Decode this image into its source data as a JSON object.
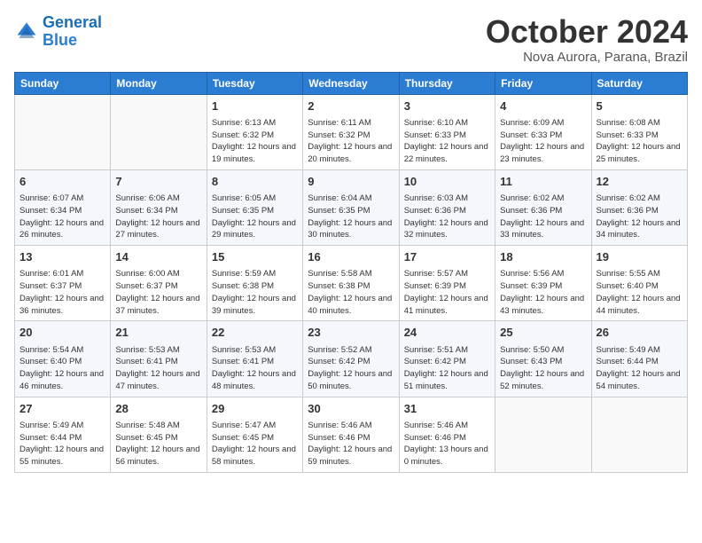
{
  "header": {
    "logo_line1": "General",
    "logo_line2": "Blue",
    "month": "October 2024",
    "location": "Nova Aurora, Parana, Brazil"
  },
  "days_of_week": [
    "Sunday",
    "Monday",
    "Tuesday",
    "Wednesday",
    "Thursday",
    "Friday",
    "Saturday"
  ],
  "weeks": [
    [
      {
        "day": "",
        "detail": ""
      },
      {
        "day": "",
        "detail": ""
      },
      {
        "day": "1",
        "detail": "Sunrise: 6:13 AM\nSunset: 6:32 PM\nDaylight: 12 hours\nand 19 minutes."
      },
      {
        "day": "2",
        "detail": "Sunrise: 6:11 AM\nSunset: 6:32 PM\nDaylight: 12 hours\nand 20 minutes."
      },
      {
        "day": "3",
        "detail": "Sunrise: 6:10 AM\nSunset: 6:33 PM\nDaylight: 12 hours\nand 22 minutes."
      },
      {
        "day": "4",
        "detail": "Sunrise: 6:09 AM\nSunset: 6:33 PM\nDaylight: 12 hours\nand 23 minutes."
      },
      {
        "day": "5",
        "detail": "Sunrise: 6:08 AM\nSunset: 6:33 PM\nDaylight: 12 hours\nand 25 minutes."
      }
    ],
    [
      {
        "day": "6",
        "detail": "Sunrise: 6:07 AM\nSunset: 6:34 PM\nDaylight: 12 hours\nand 26 minutes."
      },
      {
        "day": "7",
        "detail": "Sunrise: 6:06 AM\nSunset: 6:34 PM\nDaylight: 12 hours\nand 27 minutes."
      },
      {
        "day": "8",
        "detail": "Sunrise: 6:05 AM\nSunset: 6:35 PM\nDaylight: 12 hours\nand 29 minutes."
      },
      {
        "day": "9",
        "detail": "Sunrise: 6:04 AM\nSunset: 6:35 PM\nDaylight: 12 hours\nand 30 minutes."
      },
      {
        "day": "10",
        "detail": "Sunrise: 6:03 AM\nSunset: 6:36 PM\nDaylight: 12 hours\nand 32 minutes."
      },
      {
        "day": "11",
        "detail": "Sunrise: 6:02 AM\nSunset: 6:36 PM\nDaylight: 12 hours\nand 33 minutes."
      },
      {
        "day": "12",
        "detail": "Sunrise: 6:02 AM\nSunset: 6:36 PM\nDaylight: 12 hours\nand 34 minutes."
      }
    ],
    [
      {
        "day": "13",
        "detail": "Sunrise: 6:01 AM\nSunset: 6:37 PM\nDaylight: 12 hours\nand 36 minutes."
      },
      {
        "day": "14",
        "detail": "Sunrise: 6:00 AM\nSunset: 6:37 PM\nDaylight: 12 hours\nand 37 minutes."
      },
      {
        "day": "15",
        "detail": "Sunrise: 5:59 AM\nSunset: 6:38 PM\nDaylight: 12 hours\nand 39 minutes."
      },
      {
        "day": "16",
        "detail": "Sunrise: 5:58 AM\nSunset: 6:38 PM\nDaylight: 12 hours\nand 40 minutes."
      },
      {
        "day": "17",
        "detail": "Sunrise: 5:57 AM\nSunset: 6:39 PM\nDaylight: 12 hours\nand 41 minutes."
      },
      {
        "day": "18",
        "detail": "Sunrise: 5:56 AM\nSunset: 6:39 PM\nDaylight: 12 hours\nand 43 minutes."
      },
      {
        "day": "19",
        "detail": "Sunrise: 5:55 AM\nSunset: 6:40 PM\nDaylight: 12 hours\nand 44 minutes."
      }
    ],
    [
      {
        "day": "20",
        "detail": "Sunrise: 5:54 AM\nSunset: 6:40 PM\nDaylight: 12 hours\nand 46 minutes."
      },
      {
        "day": "21",
        "detail": "Sunrise: 5:53 AM\nSunset: 6:41 PM\nDaylight: 12 hours\nand 47 minutes."
      },
      {
        "day": "22",
        "detail": "Sunrise: 5:53 AM\nSunset: 6:41 PM\nDaylight: 12 hours\nand 48 minutes."
      },
      {
        "day": "23",
        "detail": "Sunrise: 5:52 AM\nSunset: 6:42 PM\nDaylight: 12 hours\nand 50 minutes."
      },
      {
        "day": "24",
        "detail": "Sunrise: 5:51 AM\nSunset: 6:42 PM\nDaylight: 12 hours\nand 51 minutes."
      },
      {
        "day": "25",
        "detail": "Sunrise: 5:50 AM\nSunset: 6:43 PM\nDaylight: 12 hours\nand 52 minutes."
      },
      {
        "day": "26",
        "detail": "Sunrise: 5:49 AM\nSunset: 6:44 PM\nDaylight: 12 hours\nand 54 minutes."
      }
    ],
    [
      {
        "day": "27",
        "detail": "Sunrise: 5:49 AM\nSunset: 6:44 PM\nDaylight: 12 hours\nand 55 minutes."
      },
      {
        "day": "28",
        "detail": "Sunrise: 5:48 AM\nSunset: 6:45 PM\nDaylight: 12 hours\nand 56 minutes."
      },
      {
        "day": "29",
        "detail": "Sunrise: 5:47 AM\nSunset: 6:45 PM\nDaylight: 12 hours\nand 58 minutes."
      },
      {
        "day": "30",
        "detail": "Sunrise: 5:46 AM\nSunset: 6:46 PM\nDaylight: 12 hours\nand 59 minutes."
      },
      {
        "day": "31",
        "detail": "Sunrise: 5:46 AM\nSunset: 6:46 PM\nDaylight: 13 hours\nand 0 minutes."
      },
      {
        "day": "",
        "detail": ""
      },
      {
        "day": "",
        "detail": ""
      }
    ]
  ]
}
